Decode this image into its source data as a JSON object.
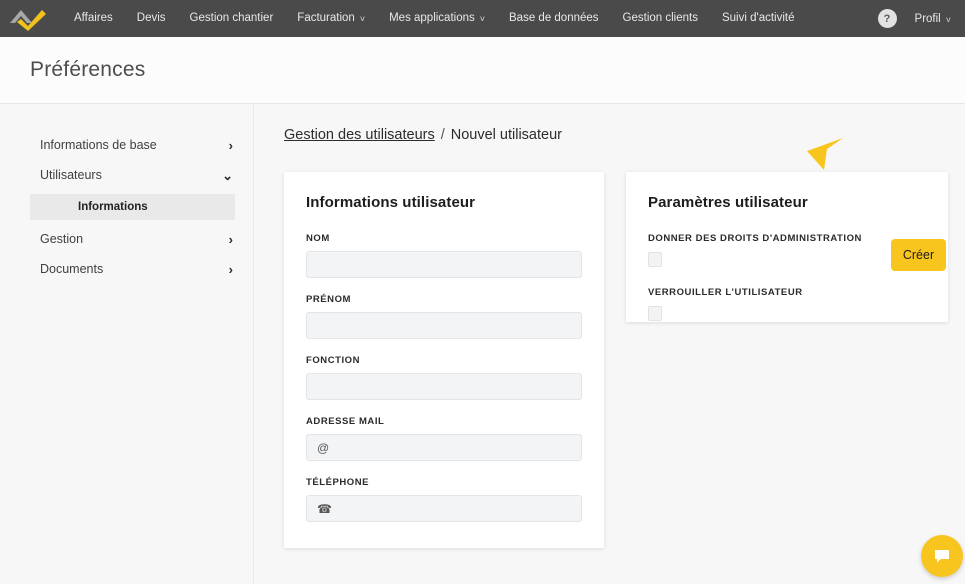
{
  "navbar": {
    "logo_name": "app-logo",
    "items": [
      {
        "label": "Affaires",
        "has_caret": false
      },
      {
        "label": "Devis",
        "has_caret": false
      },
      {
        "label": "Gestion chantier",
        "has_caret": false
      },
      {
        "label": "Facturation",
        "has_caret": true
      },
      {
        "label": "Mes applications",
        "has_caret": true
      },
      {
        "label": "Base de données",
        "has_caret": false
      },
      {
        "label": "Gestion clients",
        "has_caret": false
      },
      {
        "label": "Suivi d'activité",
        "has_caret": false
      }
    ],
    "help_label": "?",
    "profile_label": "Profil",
    "caret_glyph": "˅"
  },
  "header": {
    "title": "Préférences"
  },
  "sidebar": {
    "items": [
      {
        "label": "Informations de base",
        "chevron": "›",
        "active": false
      },
      {
        "label": "Utilisateurs",
        "chevron": "⌄",
        "active": false
      },
      {
        "label": "Gestion",
        "chevron": "›",
        "active": false
      },
      {
        "label": "Documents",
        "chevron": "›",
        "active": false
      }
    ],
    "sub_item": {
      "label": "Informations",
      "active": true
    }
  },
  "breadcrumb": {
    "link": "Gestion des utilisateurs",
    "separator": "/",
    "current": "Nouvel utilisateur"
  },
  "actions": {
    "create_label": "Créer"
  },
  "user_info_card": {
    "title": "Informations utilisateur",
    "fields": [
      {
        "label": "NOM",
        "value": "",
        "placeholder": "",
        "icon": ""
      },
      {
        "label": "PRÉNOM",
        "value": "",
        "placeholder": "",
        "icon": ""
      },
      {
        "label": "FONCTION",
        "value": "",
        "placeholder": "",
        "icon": ""
      },
      {
        "label": "ADRESSE MAIL",
        "value": "",
        "placeholder": "",
        "icon": "@"
      },
      {
        "label": "TÉLÉPHONE",
        "value": "",
        "placeholder": "",
        "icon": "☎"
      }
    ]
  },
  "user_settings_card": {
    "title": "Paramètres utilisateur",
    "checkboxes": [
      {
        "label": "DONNER DES DROITS D'ADMINISTRATION",
        "checked": false
      },
      {
        "label": "VERROUILLER L'UTILISATEUR",
        "checked": false
      }
    ]
  },
  "chat": {
    "icon_name": "chat-bubble-icon"
  },
  "colors": {
    "accent_yellow": "#f7c51e",
    "navbar_gray": "#4a4a4a",
    "page_bg": "#f7f7f7",
    "input_bg": "#f3f4f5"
  }
}
